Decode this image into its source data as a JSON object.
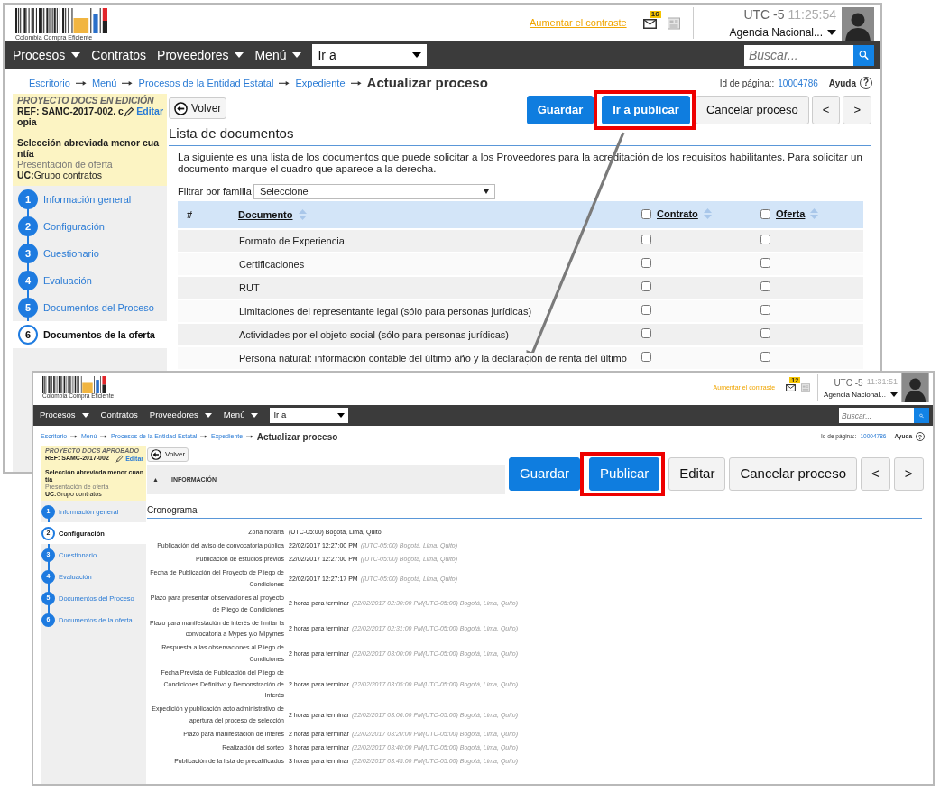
{
  "screenshots": [
    {
      "header": {
        "logo_text": "Colombia Compra Eficiente",
        "contrast_link": "Aumentar el contraste",
        "mail_count": "16",
        "timezone": "UTC -5",
        "time": "11:25:54",
        "agency": "Agencia Nacional..."
      },
      "nav": {
        "items": [
          {
            "label": "Procesos",
            "dropdown": true
          },
          {
            "label": "Contratos",
            "dropdown": false
          },
          {
            "label": "Proveedores",
            "dropdown": true
          },
          {
            "label": "Menú",
            "dropdown": true
          }
        ],
        "goto": "Ir a",
        "search_placeholder": "Buscar..."
      },
      "breadcrumbs": [
        "Escritorio",
        "Menú",
        "Procesos de la Entidad Estatal",
        "Expediente"
      ],
      "page_title": "Actualizar proceso",
      "page_id_label": "Id de página::",
      "page_id": "10004786",
      "help": "Ayuda",
      "help_glyph": "?",
      "summary": {
        "status": "PROYECTO DOCS EN EDICIÓN",
        "ref": "REF: SAMC-2017-002. copia",
        "edit": "Editar",
        "modality": "Selección abreviada menor cuantía",
        "stage": "Presentación de oferta",
        "unit": "**UC:**Grupo contratos"
      },
      "steps": [
        {
          "number": "1",
          "label": "Información general",
          "selected": false
        },
        {
          "number": "2",
          "label": "Configuración",
          "selected": false
        },
        {
          "number": "3",
          "label": "Cuestionario",
          "selected": false
        },
        {
          "number": "4",
          "label": "Evaluación",
          "selected": false
        },
        {
          "number": "5",
          "label": "Documentos del Proceso",
          "selected": false
        },
        {
          "number": "6",
          "label": "Documentos de la oferta",
          "selected": true
        }
      ],
      "back": "Volver",
      "actions": [
        {
          "label": "Guardar",
          "kind": "primary",
          "highlighted": false
        },
        {
          "label": "Ir a publicar",
          "kind": "primary",
          "highlighted": true
        },
        {
          "label": "Cancelar proceso",
          "kind": "secondary",
          "highlighted": false
        },
        {
          "label": "<",
          "kind": "secondary",
          "highlighted": false
        },
        {
          "label": ">",
          "kind": "secondary",
          "highlighted": false
        }
      ],
      "content": {
        "kind": "documents",
        "title": "Lista de documentos",
        "intro": "La siguiente es una lista de los documentos que puede solicitar a los Proveedores para la acreditación de los requisitos habilitantes. Para solicitar un documento marque el cuadro que aparece a la derecha.",
        "filter_label": "Filtrar por familia",
        "filter_value": "Seleccione",
        "columns": [
          {
            "label": "#",
            "kind": "index"
          },
          {
            "label": "Documento",
            "kind": "sort"
          },
          {
            "label": "Contrato",
            "kind": "check",
            "checked": false
          },
          {
            "label": "Oferta",
            "kind": "check",
            "checked": false
          }
        ],
        "rows": [
          {
            "name": "Formato de Experiencia",
            "contrato": false,
            "oferta": false
          },
          {
            "name": "Certificaciones",
            "contrato": false,
            "oferta": false
          },
          {
            "name": "RUT",
            "contrato": false,
            "oferta": false
          },
          {
            "name": "Limitaciones del representante legal (sólo para personas jurídicas)",
            "contrato": false,
            "oferta": false
          },
          {
            "name": "Actividades por el objeto social (sólo para personas jurídicas)",
            "contrato": false,
            "oferta": false
          },
          {
            "name": "Persona natural: información contable del último año y la declaración de renta del último",
            "contrato": false,
            "oferta": false
          }
        ]
      }
    },
    {
      "header": {
        "logo_text": "Colombia Compra Eficiente",
        "contrast_link": "Aumentar el contraste",
        "mail_count": "12",
        "timezone": "UTC -5",
        "time": "11:31:51",
        "agency": "Agencia Nacional..."
      },
      "nav": {
        "items": [
          {
            "label": "Procesos",
            "dropdown": true
          },
          {
            "label": "Contratos",
            "dropdown": false
          },
          {
            "label": "Proveedores",
            "dropdown": true
          },
          {
            "label": "Menú",
            "dropdown": true
          }
        ],
        "goto": "Ir a",
        "search_placeholder": "Buscar..."
      },
      "breadcrumbs": [
        "Escritorio",
        "Menú",
        "Procesos de la Entidad Estatal",
        "Expediente"
      ],
      "page_title": "Actualizar proceso",
      "page_id_label": "Id de página::",
      "page_id": "10004786",
      "help": "Ayuda",
      "help_glyph": "?",
      "summary": {
        "status": "PROYECTO DOCS APROBADO",
        "ref": "REF: SAMC-2017-002",
        "edit": "Editar",
        "modality": "Selección abreviada menor cuantía",
        "stage": "Presentación de oferta",
        "unit": "**UC:**Grupo contratos"
      },
      "steps": [
        {
          "number": "1",
          "label": "Información general",
          "selected": false
        },
        {
          "number": "2",
          "label": "Configuración",
          "selected": true
        },
        {
          "number": "3",
          "label": "Cuestionario",
          "selected": false
        },
        {
          "number": "4",
          "label": "Evaluación",
          "selected": false
        },
        {
          "number": "5",
          "label": "Documentos del Proceso",
          "selected": false
        },
        {
          "number": "6",
          "label": "Documentos de la oferta",
          "selected": false
        }
      ],
      "back": "Volver",
      "info_panel": {
        "glyph": "▲",
        "label": "INFORMACIÓN"
      },
      "actions": [
        {
          "label": "Guardar",
          "kind": "primary",
          "highlighted": false
        },
        {
          "label": "Publicar",
          "kind": "primary",
          "highlighted": true
        },
        {
          "label": "Editar",
          "kind": "secondary",
          "highlighted": false
        },
        {
          "label": "Cancelar proceso",
          "kind": "secondary",
          "highlighted": false
        },
        {
          "label": "<",
          "kind": "secondary",
          "highlighted": false
        },
        {
          "label": ">",
          "kind": "secondary",
          "highlighted": false
        }
      ],
      "content": {
        "kind": "schedule",
        "title": "Cronograma",
        "rows": [
          {
            "label": "Zona horaria",
            "value": "(UTC-05:00) Bogotá, Lima, Quito"
          },
          {
            "label": "Publicación del aviso de convocatoria pública",
            "value": "22/02/2017 12:27:00 PM",
            "note": "((UTC-05:00) Bogotá, Lima, Quito)"
          },
          {
            "label": "Publicación de estudios previos",
            "value": "22/02/2017 12:27:00 PM",
            "note": "((UTC-05:00) Bogotá, Lima, Quito)"
          },
          {
            "label": "Fecha de Publicación del Proyecto de Pliego de Condiciones",
            "value": "22/02/2017 12:27:17 PM",
            "note": "((UTC-05:00) Bogotá, Lima, Quito)"
          },
          {
            "label": "Plazo para presentar observaciones al proyecto de Pliego de Condiciones",
            "value": "2 horas para terminar",
            "note": "(22/02/2017 02:30:00 PM(UTC-05:00) Bogotá, Lima, Quito)"
          },
          {
            "label": "Plazo para manifestación de interés de limitar la convocatoria a Mypes y/o Mipymes",
            "value": "2 horas para terminar",
            "note": "(22/02/2017 02:31:00 PM(UTC-05:00) Bogotá, Lima, Quito)"
          },
          {
            "label": "Respuesta a las observaciones al Pliego de Condiciones",
            "value": "2 horas para terminar",
            "note": "(22/02/2017 03:00:00 PM(UTC-05:00) Bogotá, Lima, Quito)"
          },
          {
            "label": "Fecha Prevista de Publicación del Pliego de Condiciones Definitivo y Demonstración de Interés",
            "value": "2 horas para terminar",
            "note": "(22/02/2017 03:05:00 PM(UTC-05:00) Bogotá, Lima, Quito)"
          },
          {
            "label": "Expedición y publicación acto administrativo de apertura del proceso de selección",
            "value": "2 horas para terminar",
            "note": "(22/02/2017 03:06:00 PM(UTC-05:00) Bogotá, Lima, Quito)"
          },
          {
            "label": "Plazo para manifestación de Interés",
            "value": "2 horas para terminar",
            "note": "(22/02/2017 03:20:00 PM(UTC-05:00) Bogotá, Lima, Quito)"
          },
          {
            "label": "Realización del sorteo",
            "value": "3 horas para terminar",
            "note": "(22/02/2017 03:40:00 PM(UTC-05:00) Bogotá, Lima, Quito)"
          },
          {
            "label": "Publicación de la lista de precalificados",
            "value": "3 horas para terminar",
            "note": "(22/02/2017 03:45:00 PM(UTC-05:00) Bogotá, Lima, Quito)"
          }
        ]
      }
    }
  ]
}
